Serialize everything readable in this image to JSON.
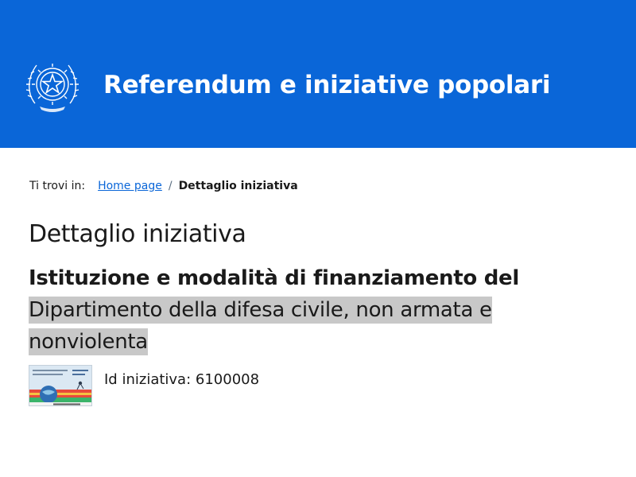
{
  "header": {
    "site_title": "Referendum e iniziative popolari",
    "emblem_icon": "italian-republic-emblem-icon",
    "background_color": "#0a66d8"
  },
  "breadcrumb": {
    "lead": "Ti trovi in:",
    "items": [
      {
        "label": "Home page",
        "link": true
      },
      {
        "label": "Dettaglio iniziativa",
        "link": false
      }
    ],
    "separator": "/"
  },
  "main": {
    "page_title": "Dettaglio iniziativa",
    "initiative_title_lines": [
      "Istituzione e modalità di finanziamento del",
      "Dipartimento della difesa civile, non armata e",
      "nonviolenta"
    ],
    "initiative_id_label": "Id iniziativa:",
    "initiative_id_value": "6100008",
    "thumbnail_icon": "initiative-thumbnail-image"
  }
}
